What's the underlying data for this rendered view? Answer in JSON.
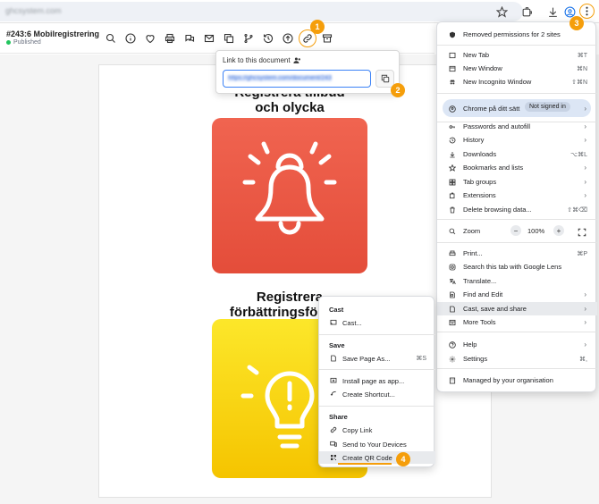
{
  "browser": {
    "url": "ghcsystem.com",
    "accent": "#f59e0b"
  },
  "toolbar": {
    "doc_title": "#243:6 Mobilregistrering",
    "doc_status": "Published"
  },
  "document": {
    "heading1_line1": "Registrera tillbud",
    "heading1_line2": "och olycka",
    "heading2_line1": "Registrera",
    "heading2_line2": "förbättringsförslag",
    "tile1_color": "#e95641",
    "tile2_color": "#f9d914"
  },
  "popover": {
    "title": "Link to this document",
    "link_value": "https://ghcsystem.com/document/243"
  },
  "chrome_menu": {
    "items": [
      {
        "label": "Removed permissions for 2 sites",
        "icon": "shield-icon"
      },
      {
        "label": "New Tab",
        "shortcut": "⌘T",
        "icon": "new-tab-icon"
      },
      {
        "label": "New Window",
        "shortcut": "⌘N",
        "icon": "new-window-icon"
      },
      {
        "label": "New Incognito Window",
        "shortcut": "⇧⌘N",
        "icon": "incognito-icon"
      },
      {
        "label": "Chrome på ditt sätt",
        "badge": "Not signed in",
        "icon": "profile-icon"
      },
      {
        "label": "Passwords and autofill",
        "icon": "key-icon"
      },
      {
        "label": "History",
        "icon": "history-icon"
      },
      {
        "label": "Downloads",
        "shortcut": "⌥⌘L",
        "icon": "download-icon"
      },
      {
        "label": "Bookmarks and lists",
        "icon": "star-icon"
      },
      {
        "label": "Tab groups",
        "icon": "tab-groups-icon"
      },
      {
        "label": "Extensions",
        "icon": "puzzle-icon"
      },
      {
        "label": "Delete browsing data...",
        "shortcut": "⇧⌘⌫",
        "icon": "trash-icon"
      },
      {
        "label": "Zoom",
        "zoom": "100%",
        "icon": "zoom-icon"
      },
      {
        "label": "Print...",
        "shortcut": "⌘P",
        "icon": "print-icon"
      },
      {
        "label": "Search this tab with Google Lens",
        "icon": "lens-icon"
      },
      {
        "label": "Translate...",
        "icon": "translate-icon"
      },
      {
        "label": "Find and Edit",
        "icon": "find-icon"
      },
      {
        "label": "Cast, save and share",
        "icon": "cast-save-icon"
      },
      {
        "label": "More Tools",
        "icon": "tools-icon"
      },
      {
        "label": "Help",
        "icon": "help-icon"
      },
      {
        "label": "Settings",
        "shortcut": "⌘,",
        "icon": "gear-icon"
      },
      {
        "label": "Managed by your organisation",
        "icon": "building-icon"
      }
    ]
  },
  "sub_menu": {
    "section_cast": "Cast",
    "cast": "Cast...",
    "section_save": "Save",
    "save_page": "Save Page As...",
    "save_shortcut": "⌘S",
    "install": "Install page as app...",
    "shortcut": "Create Shortcut...",
    "section_share": "Share",
    "copy_link": "Copy Link",
    "send_devices": "Send to Your Devices",
    "qr_code": "Create QR Code"
  },
  "steps": [
    "1",
    "2",
    "3",
    "4"
  ]
}
